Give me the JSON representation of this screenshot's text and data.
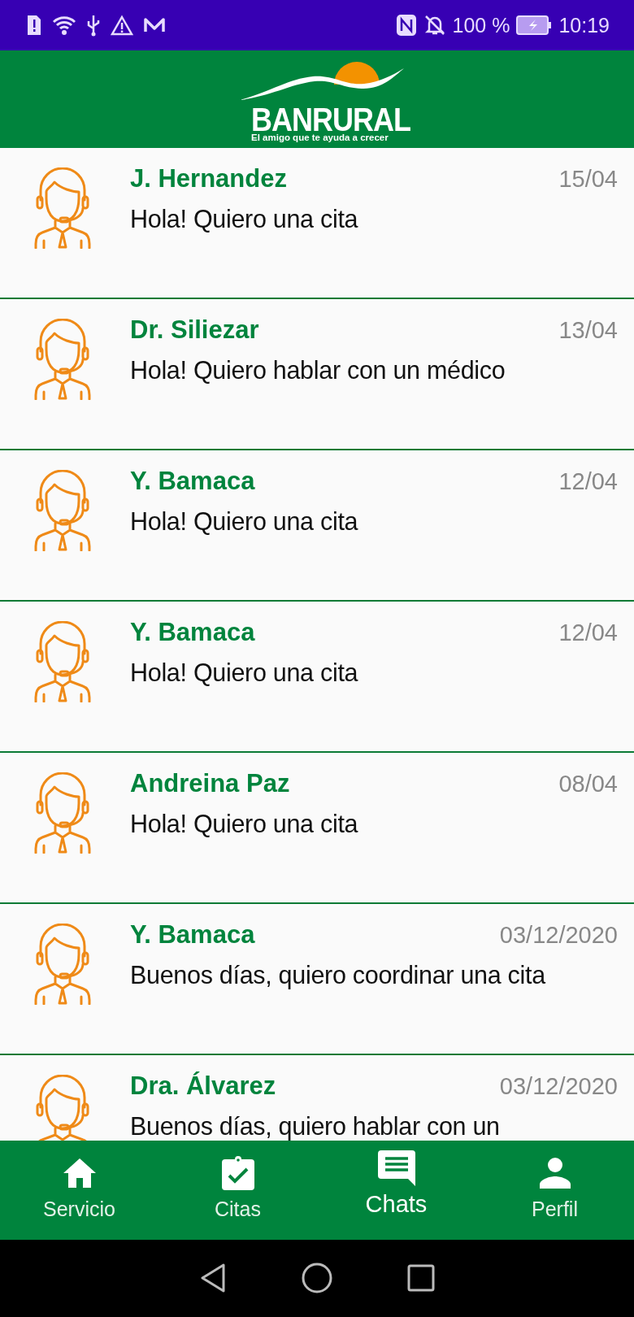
{
  "status_bar": {
    "battery": "100 %",
    "time": "10:19"
  },
  "header": {
    "logo_name": "BANRURAL",
    "logo_tagline": "El amigo que te ayuda a crecer"
  },
  "chats": [
    {
      "name": "J. Hernandez",
      "date": "15/04",
      "message": "Hola! Quiero una cita"
    },
    {
      "name": "Dr. Siliezar",
      "date": "13/04",
      "message": "Hola! Quiero hablar con un médico"
    },
    {
      "name": "Y. Bamaca",
      "date": "12/04",
      "message": "Hola! Quiero una cita"
    },
    {
      "name": "Y. Bamaca",
      "date": "12/04",
      "message": "Hola! Quiero una cita"
    },
    {
      "name": "Andreina Paz",
      "date": "08/04",
      "message": "Hola! Quiero una cita"
    },
    {
      "name": "Y. Bamaca",
      "date": "03/12/2020",
      "message": "Buenos días, quiero coordinar una cita"
    },
    {
      "name": "Dra. Álvarez",
      "date": "03/12/2020",
      "message": "Buenos días, quiero hablar con un"
    }
  ],
  "bottom_nav": [
    {
      "label": "Servicio",
      "selected": false
    },
    {
      "label": "Citas",
      "selected": false
    },
    {
      "label": "Chats",
      "selected": true
    },
    {
      "label": "Perfil",
      "selected": false
    }
  ]
}
